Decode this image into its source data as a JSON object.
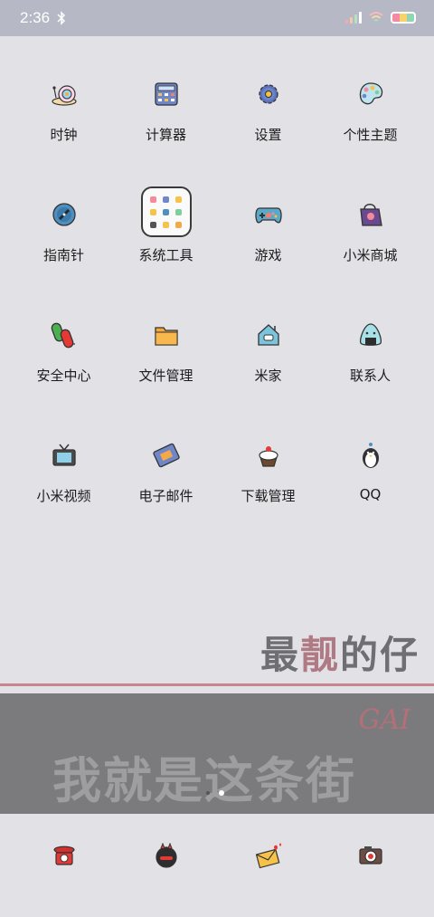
{
  "status_bar": {
    "time": "2:36",
    "colors": {
      "background": "#b6b8c5"
    }
  },
  "apps": [
    [
      {
        "label": "时钟",
        "icon": "snail-clock-icon"
      },
      {
        "label": "计算器",
        "icon": "calculator-icon"
      },
      {
        "label": "设置",
        "icon": "gear-icon"
      },
      {
        "label": "个性主题",
        "icon": "palette-icon"
      }
    ],
    [
      {
        "label": "指南针",
        "icon": "compass-icon"
      },
      {
        "label": "系统工具",
        "icon": "folder-icon"
      },
      {
        "label": "游戏",
        "icon": "gamepad-icon"
      },
      {
        "label": "小米商城",
        "icon": "shopping-bag-icon"
      }
    ],
    [
      {
        "label": "安全中心",
        "icon": "pill-icon"
      },
      {
        "label": "文件管理",
        "icon": "file-folder-icon"
      },
      {
        "label": "米家",
        "icon": "house-icon"
      },
      {
        "label": "联系人",
        "icon": "onigiri-icon"
      }
    ],
    [
      {
        "label": "小米视频",
        "icon": "tv-icon"
      },
      {
        "label": "电子邮件",
        "icon": "envelope-icon"
      },
      {
        "label": "下载管理",
        "icon": "cupcake-icon"
      },
      {
        "label": "QQ",
        "icon": "penguin-icon"
      }
    ]
  ],
  "wallpaper": {
    "slogan_line1_a": "最",
    "slogan_line1_b": "靓",
    "slogan_line1_c": "的仔",
    "gai": "GAI",
    "slogan_line2": "我就是这条街",
    "colors": {
      "accent_pink": "#c7868e",
      "band": "#7b7b7d"
    }
  },
  "dock": [
    {
      "icon": "phone-icon"
    },
    {
      "icon": "message-bubble-icon"
    },
    {
      "icon": "love-letter-icon"
    },
    {
      "icon": "camera-icon"
    }
  ]
}
